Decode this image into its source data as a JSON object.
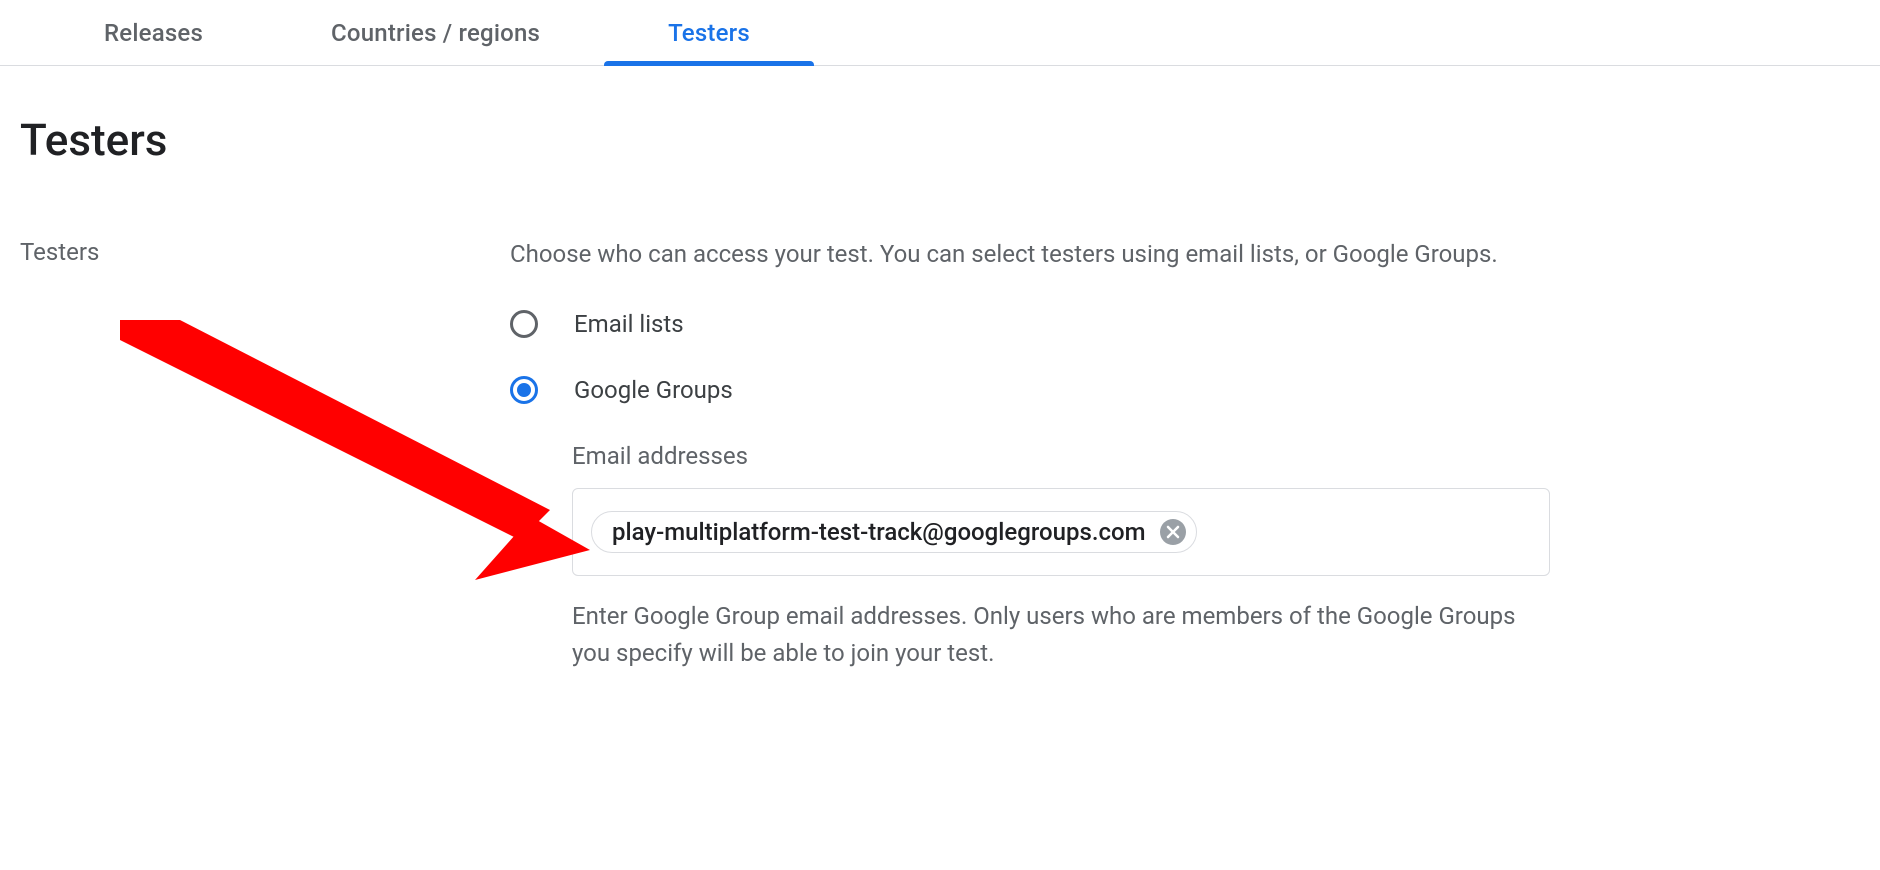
{
  "tabs": {
    "releases": "Releases",
    "countries": "Countries / regions",
    "testers": "Testers"
  },
  "heading": "Testers",
  "section": {
    "side_label": "Testers",
    "description": "Choose who can access your test. You can select testers using email lists, or Google Groups.",
    "radio": {
      "email_lists": "Email lists",
      "google_groups": "Google Groups"
    },
    "email_field": {
      "label": "Email addresses",
      "chip": "play-multiplatform-test-track@googlegroups.com",
      "helper": "Enter Google Group email addresses. Only users who are members of the Google Groups you specify will be able to join your test."
    }
  }
}
